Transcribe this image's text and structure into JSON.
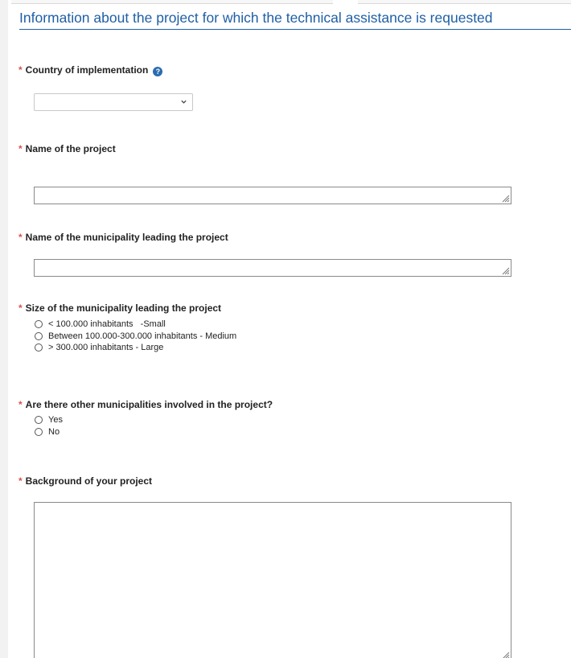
{
  "section": {
    "title": "Information about the project for which the technical assistance is requested"
  },
  "required_marker": "*",
  "help_icon_glyph": "?",
  "country": {
    "label": "Country of implementation",
    "selected_value": ""
  },
  "project_name": {
    "label": "Name of the project",
    "value": ""
  },
  "municipality_name": {
    "label": "Name of the municipality leading the project",
    "value": ""
  },
  "municipality_size": {
    "label": "Size of the municipality leading the project",
    "options": [
      "< 100.000 inhabitants   -Small",
      "Between 100.000-300.000 inhabitants - Medium",
      "> 300.000 inhabitants - Large"
    ]
  },
  "other_municipalities": {
    "label": "Are there other municipalities involved in the project?",
    "options": [
      "Yes",
      "No"
    ]
  },
  "background": {
    "label": "Background of your project",
    "value": ""
  },
  "colors": {
    "title_blue": "#1f5fa6",
    "required_red": "#d9534f",
    "help_icon_blue": "#2b6cb0"
  }
}
